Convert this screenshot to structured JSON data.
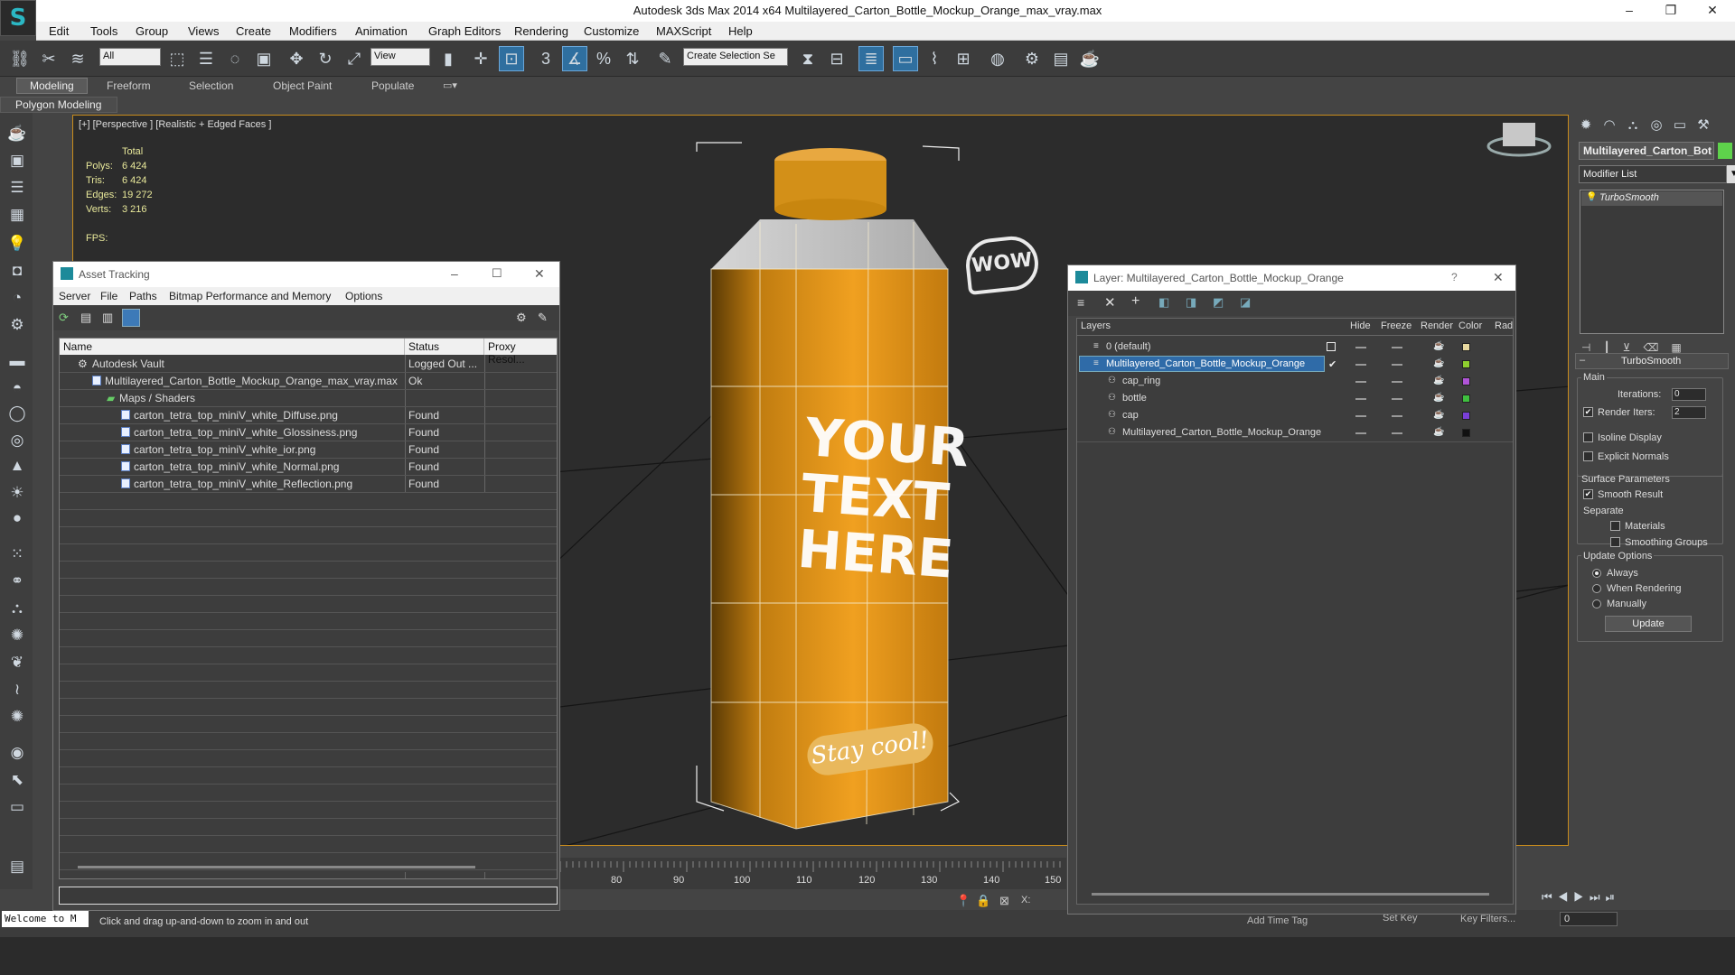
{
  "app": {
    "title": "Autodesk 3ds Max  2014 x64     Multilayered_Carton_Bottle_Mockup_Orange_max_vray.max",
    "logo_glyph": "S"
  },
  "window_controls": {
    "minimize": "–",
    "maximize": "❐",
    "close": "✕"
  },
  "menu": [
    "Edit",
    "Tools",
    "Group",
    "Views",
    "Create",
    "Modifiers",
    "Animation",
    "Graph Editors",
    "Rendering",
    "Customize",
    "MAXScript",
    "Help"
  ],
  "toolbar": {
    "selection_filter": "All",
    "ref_coord": "View",
    "named_selection": "Create Selection Se",
    "snap_label": "3",
    "percent_label": "%"
  },
  "ribbon": {
    "tabs": [
      "Modeling",
      "Freeform",
      "Selection",
      "Object Paint",
      "Populate"
    ],
    "active_tab": "Modeling",
    "panel_label": "Polygon Modeling"
  },
  "viewport": {
    "label": "[+] [Perspective ] [Realistic + Edged Faces ]",
    "stats": {
      "total_label": "Total",
      "rows": [
        {
          "key": "Polys:",
          "value": "6 424"
        },
        {
          "key": "Tris:",
          "value": "6 424"
        },
        {
          "key": "Edges:",
          "value": "19 272"
        },
        {
          "key": "Verts:",
          "value": "3 216"
        }
      ],
      "fps_label": "FPS:"
    },
    "bottle_text": {
      "bubble": "WOW",
      "headline": [
        "YOUR",
        "TEXT",
        "HERE"
      ],
      "tagline": "Stay cool!"
    }
  },
  "command_panel": {
    "object_name": "Multilayered_Carton_Bot",
    "object_color": "#5ed24b",
    "modifier_list": "Modifier List",
    "stack_item": "TurboSmooth",
    "rollout_title": "TurboSmooth",
    "main": {
      "title": "Main",
      "iterations_label": "Iterations:",
      "iterations_value": "0",
      "render_iters_label": "Render Iters:",
      "render_iters_value": "2",
      "render_iters_checked": true,
      "isoline_label": "Isoline Display",
      "explicit_normals_label": "Explicit Normals"
    },
    "surface": {
      "title": "Surface Parameters",
      "smooth_result_label": "Smooth Result",
      "separate_label": "Separate",
      "materials_label": "Materials",
      "smoothing_groups_label": "Smoothing Groups"
    },
    "update": {
      "title": "Update Options",
      "always_label": "Always",
      "when_rendering_label": "When Rendering",
      "manually_label": "Manually",
      "update_button": "Update"
    }
  },
  "asset_tracking": {
    "title": "Asset Tracking",
    "menu": [
      "Server",
      "File",
      "Paths",
      "Bitmap Performance and Memory",
      "Options"
    ],
    "columns": [
      "Name",
      "Status",
      "Proxy Resol..."
    ],
    "rows": [
      {
        "name": "Autodesk Vault",
        "status": "Logged Out ..."
      },
      {
        "name": "Multilayered_Carton_Bottle_Mockup_Orange_max_vray.max",
        "status": "Ok"
      },
      {
        "name": "Maps / Shaders",
        "status": ""
      },
      {
        "name": "carton_tetra_top_miniV_white_Diffuse.png",
        "status": "Found"
      },
      {
        "name": "carton_tetra_top_miniV_white_Glossiness.png",
        "status": "Found"
      },
      {
        "name": "carton_tetra_top_miniV_white_ior.png",
        "status": "Found"
      },
      {
        "name": "carton_tetra_top_miniV_white_Normal.png",
        "status": "Found"
      },
      {
        "name": "carton_tetra_top_miniV_white_Reflection.png",
        "status": "Found"
      }
    ]
  },
  "layer_window": {
    "title": "Layer: Multilayered_Carton_Bottle_Mockup_Orange",
    "help": "?",
    "columns": [
      "Layers",
      "Hide",
      "Freeze",
      "Render",
      "Color",
      "Rad"
    ],
    "rows": [
      {
        "name": "0 (default)",
        "color": "#e8d9a0"
      },
      {
        "name": "Multilayered_Carton_Bottle_Mockup_Orange",
        "color": "#8fcf2f"
      },
      {
        "name": "cap_ring",
        "color": "#b054d8"
      },
      {
        "name": "bottle",
        "color": "#3fbf3f"
      },
      {
        "name": "cap",
        "color": "#7a3fd8"
      },
      {
        "name": "Multilayered_Carton_Bottle_Mockup_Orange",
        "color": "#111111"
      }
    ]
  },
  "timeline": {
    "ticks": [
      "80",
      "90",
      "100",
      "110",
      "120",
      "130",
      "140",
      "150"
    ]
  },
  "status": {
    "prompt": "Welcome to M",
    "message": "Click and drag up-and-down to zoom in and out",
    "add_time_tag": "Add Time Tag",
    "set_key": "Set Key",
    "key_filters": "Key Filters...",
    "frame_value": "0",
    "x_label": "X:"
  }
}
